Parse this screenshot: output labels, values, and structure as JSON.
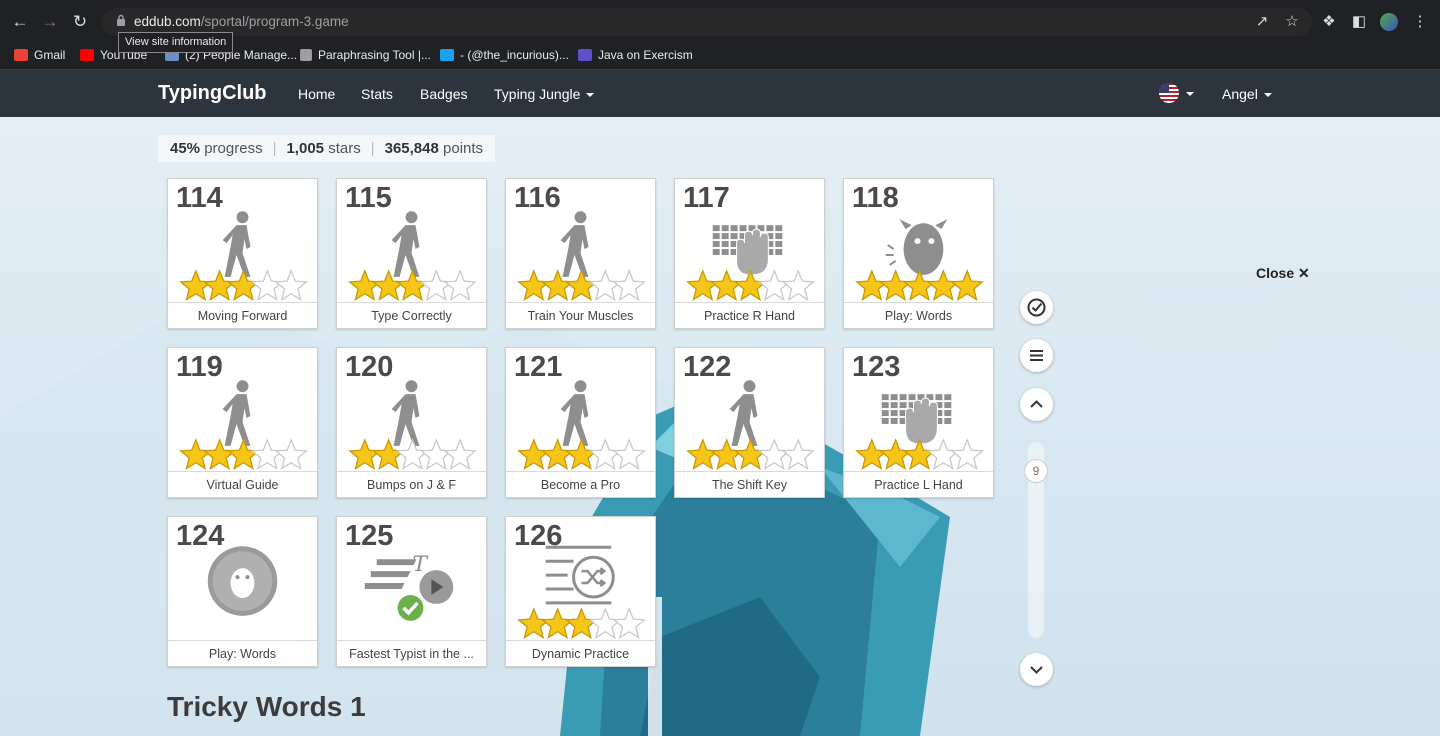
{
  "browser": {
    "url_host": "eddub.com",
    "url_path": "/sportal/program-3.game",
    "tooltip": "View site information",
    "bookmarks": [
      "Gmail",
      "YouTube",
      "(2) People Manage...",
      "Paraphrasing Tool |...",
      "- (@the_incurious)...",
      "Java on Exercism"
    ]
  },
  "nav": {
    "brand": "TypingClub",
    "links": [
      "Home",
      "Stats",
      "Badges",
      "Typing Jungle"
    ],
    "user": "Angel"
  },
  "stats": {
    "progress_value": "45%",
    "progress_label": "progress",
    "stars_value": "1,005",
    "stars_label": "stars",
    "points_value": "365,848",
    "points_label": "points"
  },
  "lessons": [
    {
      "num": "114",
      "label": "Moving Forward",
      "icon": "walking-person",
      "stars": 3
    },
    {
      "num": "115",
      "label": "Type Correctly",
      "icon": "walking-person",
      "stars": 3
    },
    {
      "num": "116",
      "label": "Train Your Muscles",
      "icon": "walking-person",
      "stars": 3
    },
    {
      "num": "117",
      "label": "Practice R Hand",
      "icon": "keyboard-hand",
      "stars": 3
    },
    {
      "num": "118",
      "label": "Play: Words",
      "icon": "monster",
      "stars": 5
    },
    {
      "num": "119",
      "label": "Virtual Guide",
      "icon": "walking-person",
      "stars": 3
    },
    {
      "num": "120",
      "label": "Bumps on J & F",
      "icon": "walking-person",
      "stars": 2
    },
    {
      "num": "121",
      "label": "Become a Pro",
      "icon": "walking-person",
      "stars": 3
    },
    {
      "num": "122",
      "label": "The Shift Key",
      "icon": "walking-person",
      "stars": 3
    },
    {
      "num": "123",
      "label": "Practice L Hand",
      "icon": "keyboard-hand",
      "stars": 3
    },
    {
      "num": "124",
      "label": "Play: Words",
      "icon": "game-badge",
      "stars": 0
    },
    {
      "num": "125",
      "label": "Fastest Typist in the ...",
      "icon": "speed-video",
      "stars": 0
    },
    {
      "num": "126",
      "label": "Dynamic Practice",
      "icon": "shuffle-text",
      "stars": 3
    }
  ],
  "side": {
    "scroll_number": "9",
    "close_label": "Close"
  },
  "section_title": "Tricky Words 1",
  "colors": {
    "nav_bg": "#2c343d",
    "star_gold": "#f5c518",
    "check_green": "#6ab04c"
  }
}
